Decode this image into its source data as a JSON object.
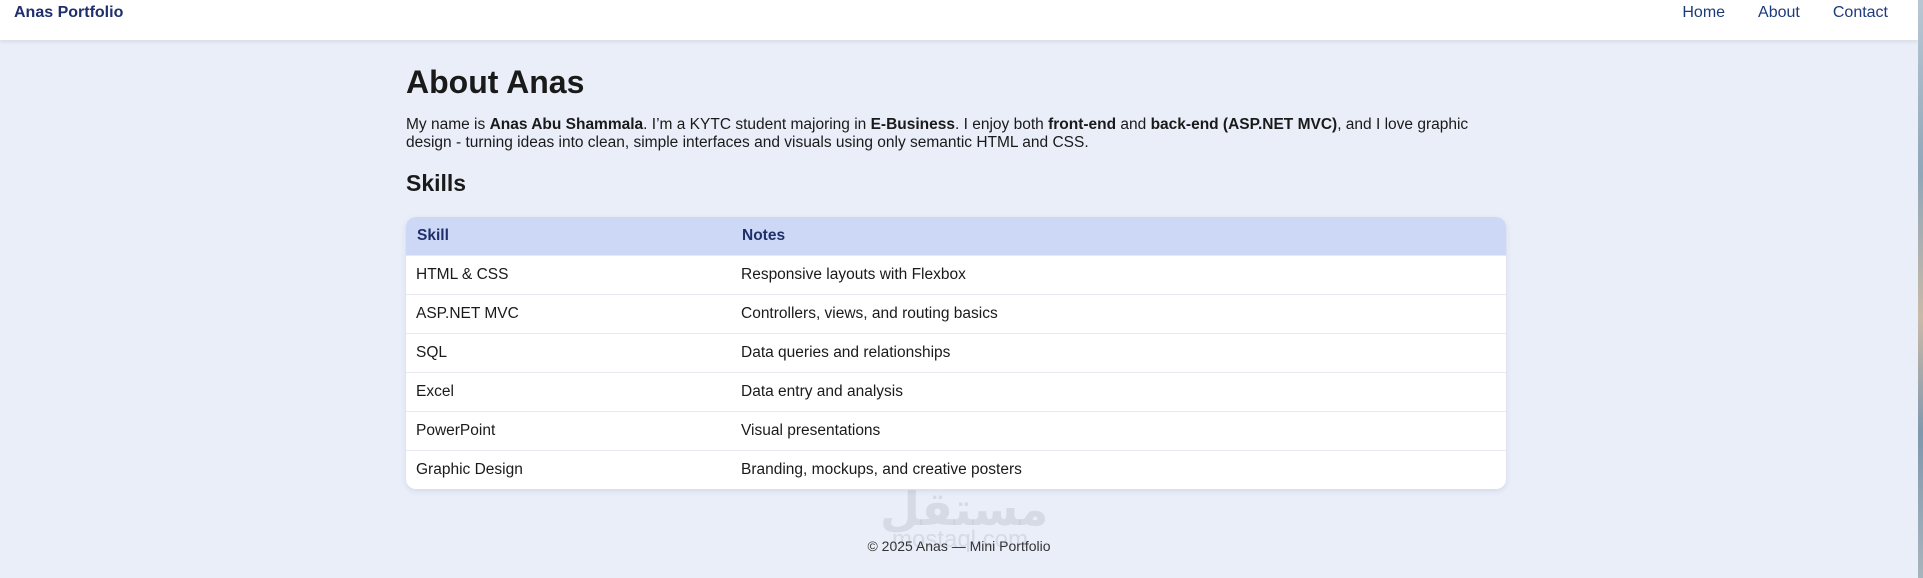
{
  "header": {
    "brand": "Anas Portfolio",
    "nav": [
      "Home",
      "About",
      "Contact"
    ]
  },
  "main": {
    "title": "About Anas",
    "intro": {
      "p1": "My name is ",
      "name": "Anas Abu Shammala",
      "p2": ". I’m a KYTC student majoring in ",
      "major": "E-Business",
      "p3": ". I enjoy both ",
      "fe": "front-end",
      "p4": " and ",
      "be": "back-end (ASP.NET MVC)",
      "p5": ", and I love graphic design - turning ideas into clean, simple interfaces and visuals using only semantic HTML and CSS."
    },
    "skills_heading": "Skills",
    "table": {
      "headers": [
        "Skill",
        "Notes"
      ],
      "rows": [
        [
          "HTML & CSS",
          "Responsive layouts with Flexbox"
        ],
        [
          "ASP.NET MVC",
          "Controllers, views, and routing basics"
        ],
        [
          "SQL",
          "Data queries and relationships"
        ],
        [
          "Excel",
          "Data entry and analysis"
        ],
        [
          "PowerPoint",
          "Visual presentations"
        ],
        [
          "Graphic Design",
          "Branding, mockups, and creative posters"
        ]
      ]
    }
  },
  "footer": {
    "text": "© 2025 Anas — Mini Portfolio"
  },
  "watermark": {
    "arabic": "مستقل",
    "latin": "mostaql.com"
  },
  "colors": {
    "background": "#e9eef9",
    "accent": "#1e2f6b",
    "table_header": "#cdd8f6"
  }
}
